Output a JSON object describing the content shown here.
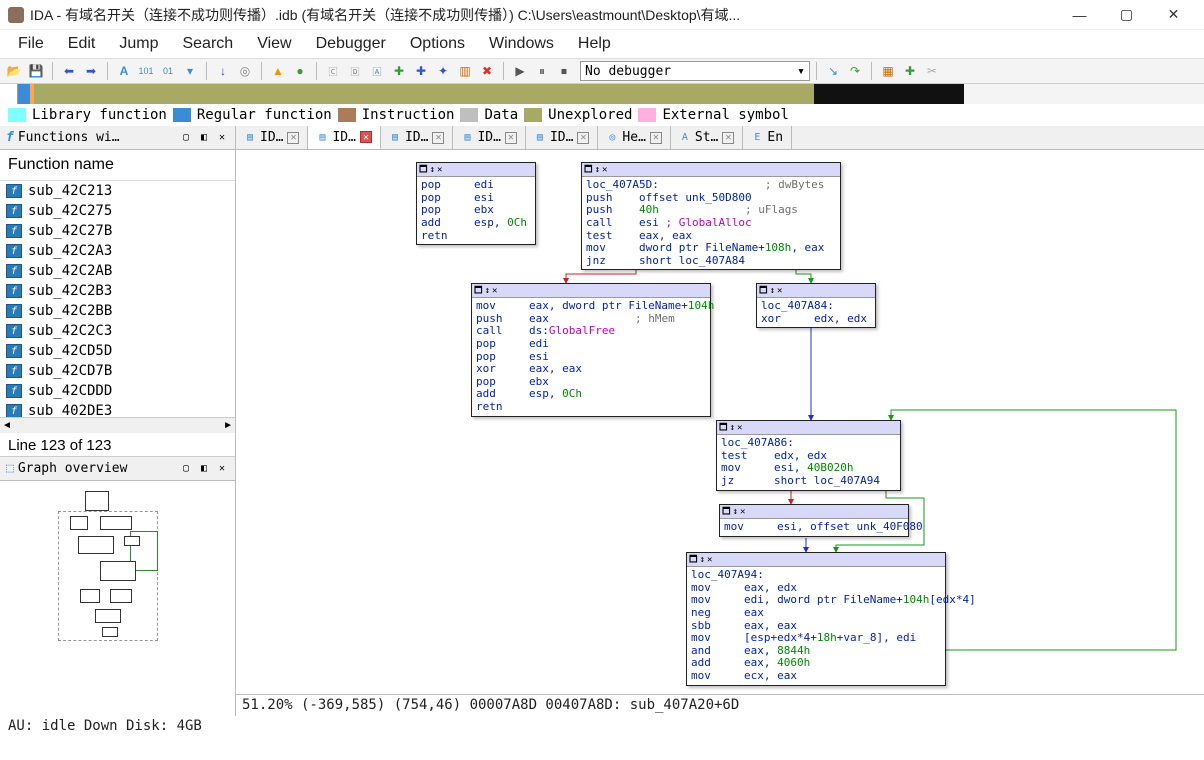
{
  "window": {
    "title": "IDA - 有域名开关（连接不成功则传播）.idb (有域名开关（连接不成功则传播）) C:\\Users\\eastmount\\Desktop\\有域..."
  },
  "menu": [
    "File",
    "Edit",
    "Jump",
    "Search",
    "View",
    "Debugger",
    "Options",
    "Windows",
    "Help"
  ],
  "debugger_select": "No debugger",
  "legend": [
    {
      "color": "#7fffff",
      "label": "Library function"
    },
    {
      "color": "#3a8cd6",
      "label": "Regular function"
    },
    {
      "color": "#ac7b5a",
      "label": "Instruction"
    },
    {
      "color": "#bfbfbf",
      "label": "Data"
    },
    {
      "color": "#a9a966",
      "label": "Unexplored"
    },
    {
      "color": "#ffb0e0",
      "label": "External symbol"
    }
  ],
  "functions_window": {
    "title": "Functions wi…",
    "header": "Function name",
    "items": [
      "sub_42C213",
      "sub_42C275",
      "sub_42C27B",
      "sub_42C2A3",
      "sub_42C2AB",
      "sub_42C2B3",
      "sub_42C2BB",
      "sub_42C2C3",
      "sub_42CD5D",
      "sub_42CD7B",
      "sub_42CDDD",
      "sub_402DE3"
    ],
    "line_status": "Line 123 of 123"
  },
  "overview_title": "Graph overview",
  "tabs": [
    {
      "icon": "ida",
      "label": "ID…",
      "close": true,
      "active": false
    },
    {
      "icon": "ida",
      "label": "ID…",
      "close": true,
      "active": true
    },
    {
      "icon": "ida",
      "label": "ID…",
      "close": true,
      "active": false
    },
    {
      "icon": "ida",
      "label": "ID…",
      "close": true,
      "active": false
    },
    {
      "icon": "ida",
      "label": "ID…",
      "close": true,
      "active": false
    },
    {
      "icon": "hex",
      "label": "He…",
      "close": true,
      "active": false
    },
    {
      "icon": "str",
      "label": "St…",
      "close": true,
      "active": false
    },
    {
      "icon": "enum",
      "label": "En",
      "close": false,
      "active": false
    }
  ],
  "blocks": {
    "b1_lines": "pop     edi\npop     esi\npop     ebx\nadd     esp, <g>0Ch</g>\nretn",
    "b2_lines": "<lbl>loc_407A5D:</lbl>                <cmt>; dwBytes</cmt>\npush    offset unk_50D800\npush    <g>40h</g>             <cmt>; uFlags</cmt>\ncall    esi <call>; GlobalAlloc</call>\ntest    eax, eax\nmov     dword ptr FileName+<g>108h</g>, eax\njnz     short loc_407A84",
    "b3_lines": "mov     eax, dword ptr FileName+<g>104h</g>\npush    eax             <cmt>; hMem</cmt>\ncall    ds:<call>GlobalFree</call>\npop     edi\npop     esi\nxor     eax, eax\npop     ebx\nadd     esp, <g>0Ch</g>\nretn",
    "b4_lines": "<lbl>loc_407A84:</lbl>\nxor     edx, edx",
    "b5_lines": "<lbl>loc_407A86:</lbl>\ntest    edx, edx\nmov     esi, <g>40B020h</g>\njz      short loc_407A94",
    "b6_lines": "mov     esi, offset unk_40F080",
    "b7_lines": "<lbl>loc_407A94:</lbl>\nmov     eax, edx\nmov     edi, dword ptr FileName+<g>104h</g>[edx*4]\nneg     eax\nsbb     eax, eax\nmov     [esp+edx*4+<g>18h</g>+var_8], edi\nand     eax, <g>8844h</g>\nadd     eax, <g>4060h</g>\nmov     ecx, eax"
  },
  "graph_status": "51.20% (-369,585) (754,46) 00007A8D 00407A8D: sub_407A20+6D",
  "statusbar": "AU:  idle  Down    Disk: 4GB"
}
